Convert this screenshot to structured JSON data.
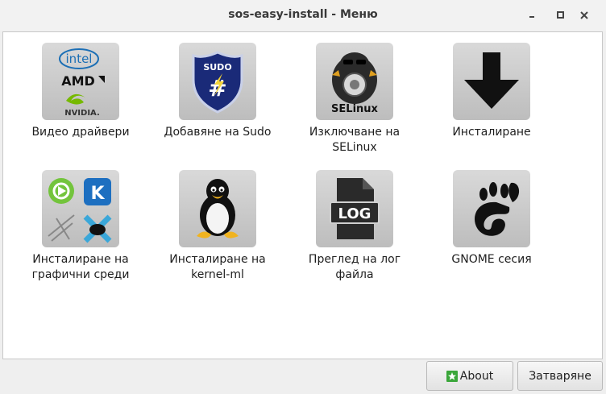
{
  "window": {
    "title": "sos-easy-install - Меню"
  },
  "titlebar_icons": [
    "minimize-icon",
    "maximize-icon",
    "close-icon"
  ],
  "items": [
    {
      "label": "Видео драйвери",
      "icon": "video-drivers-icon",
      "icon_text": [
        "intel",
        "AMD",
        "NVIDIA."
      ]
    },
    {
      "label": "Добавяне на Sudo",
      "icon": "sudo-shield-icon",
      "icon_text": [
        "SUDO"
      ]
    },
    {
      "label": "Изключване на\nSELinux",
      "icon": "selinux-penguin-icon",
      "icon_text": [
        "SELinux"
      ]
    },
    {
      "label": "Инсталиране",
      "icon": "download-arrow-icon"
    },
    {
      "label": "Инсталиране на\nграфични среди",
      "icon": "desktop-environments-icon"
    },
    {
      "label": "Инсталиране на\nkernel-ml",
      "icon": "tux-penguin-icon"
    },
    {
      "label": "Преглед на лог\nфайла",
      "icon": "log-file-icon",
      "icon_text": [
        "LOG"
      ]
    },
    {
      "label": "GNOME сесия",
      "icon": "gnome-foot-icon"
    }
  ],
  "buttons": {
    "about": {
      "label": "About",
      "icon": "about-star-icon"
    },
    "close": {
      "label": "Затваряне"
    }
  },
  "colors": {
    "accent_green": "#3aa63a",
    "tile_bg": "#cfcfcf"
  }
}
